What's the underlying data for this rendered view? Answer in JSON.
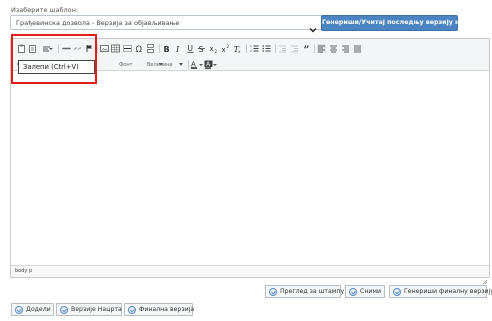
{
  "template": {
    "label": "Изаберите шаблон:",
    "selected": "Грађевинска дозвола - Верзија за објављивање",
    "generate_button": "Генериши/Учитај последњу верзију нацрта"
  },
  "editor": {
    "toolbar": {
      "font_label": "Фонт",
      "size_label": "Величина",
      "format_label": "Ст"
    },
    "tooltip": "Залепи (Ctrl+V)",
    "status_path": "body  p"
  },
  "actions": {
    "preview_print": "Преглед за штампу",
    "save": "Сними",
    "generate_final": "Генериши финалну верзију"
  },
  "tabs": {
    "attach": "Додели",
    "draft_versions": "Верзије Нацрта",
    "final_version": "Финална верзија"
  },
  "colors": {
    "accent": "#4b84c1",
    "highlight": "#e01e1e"
  }
}
